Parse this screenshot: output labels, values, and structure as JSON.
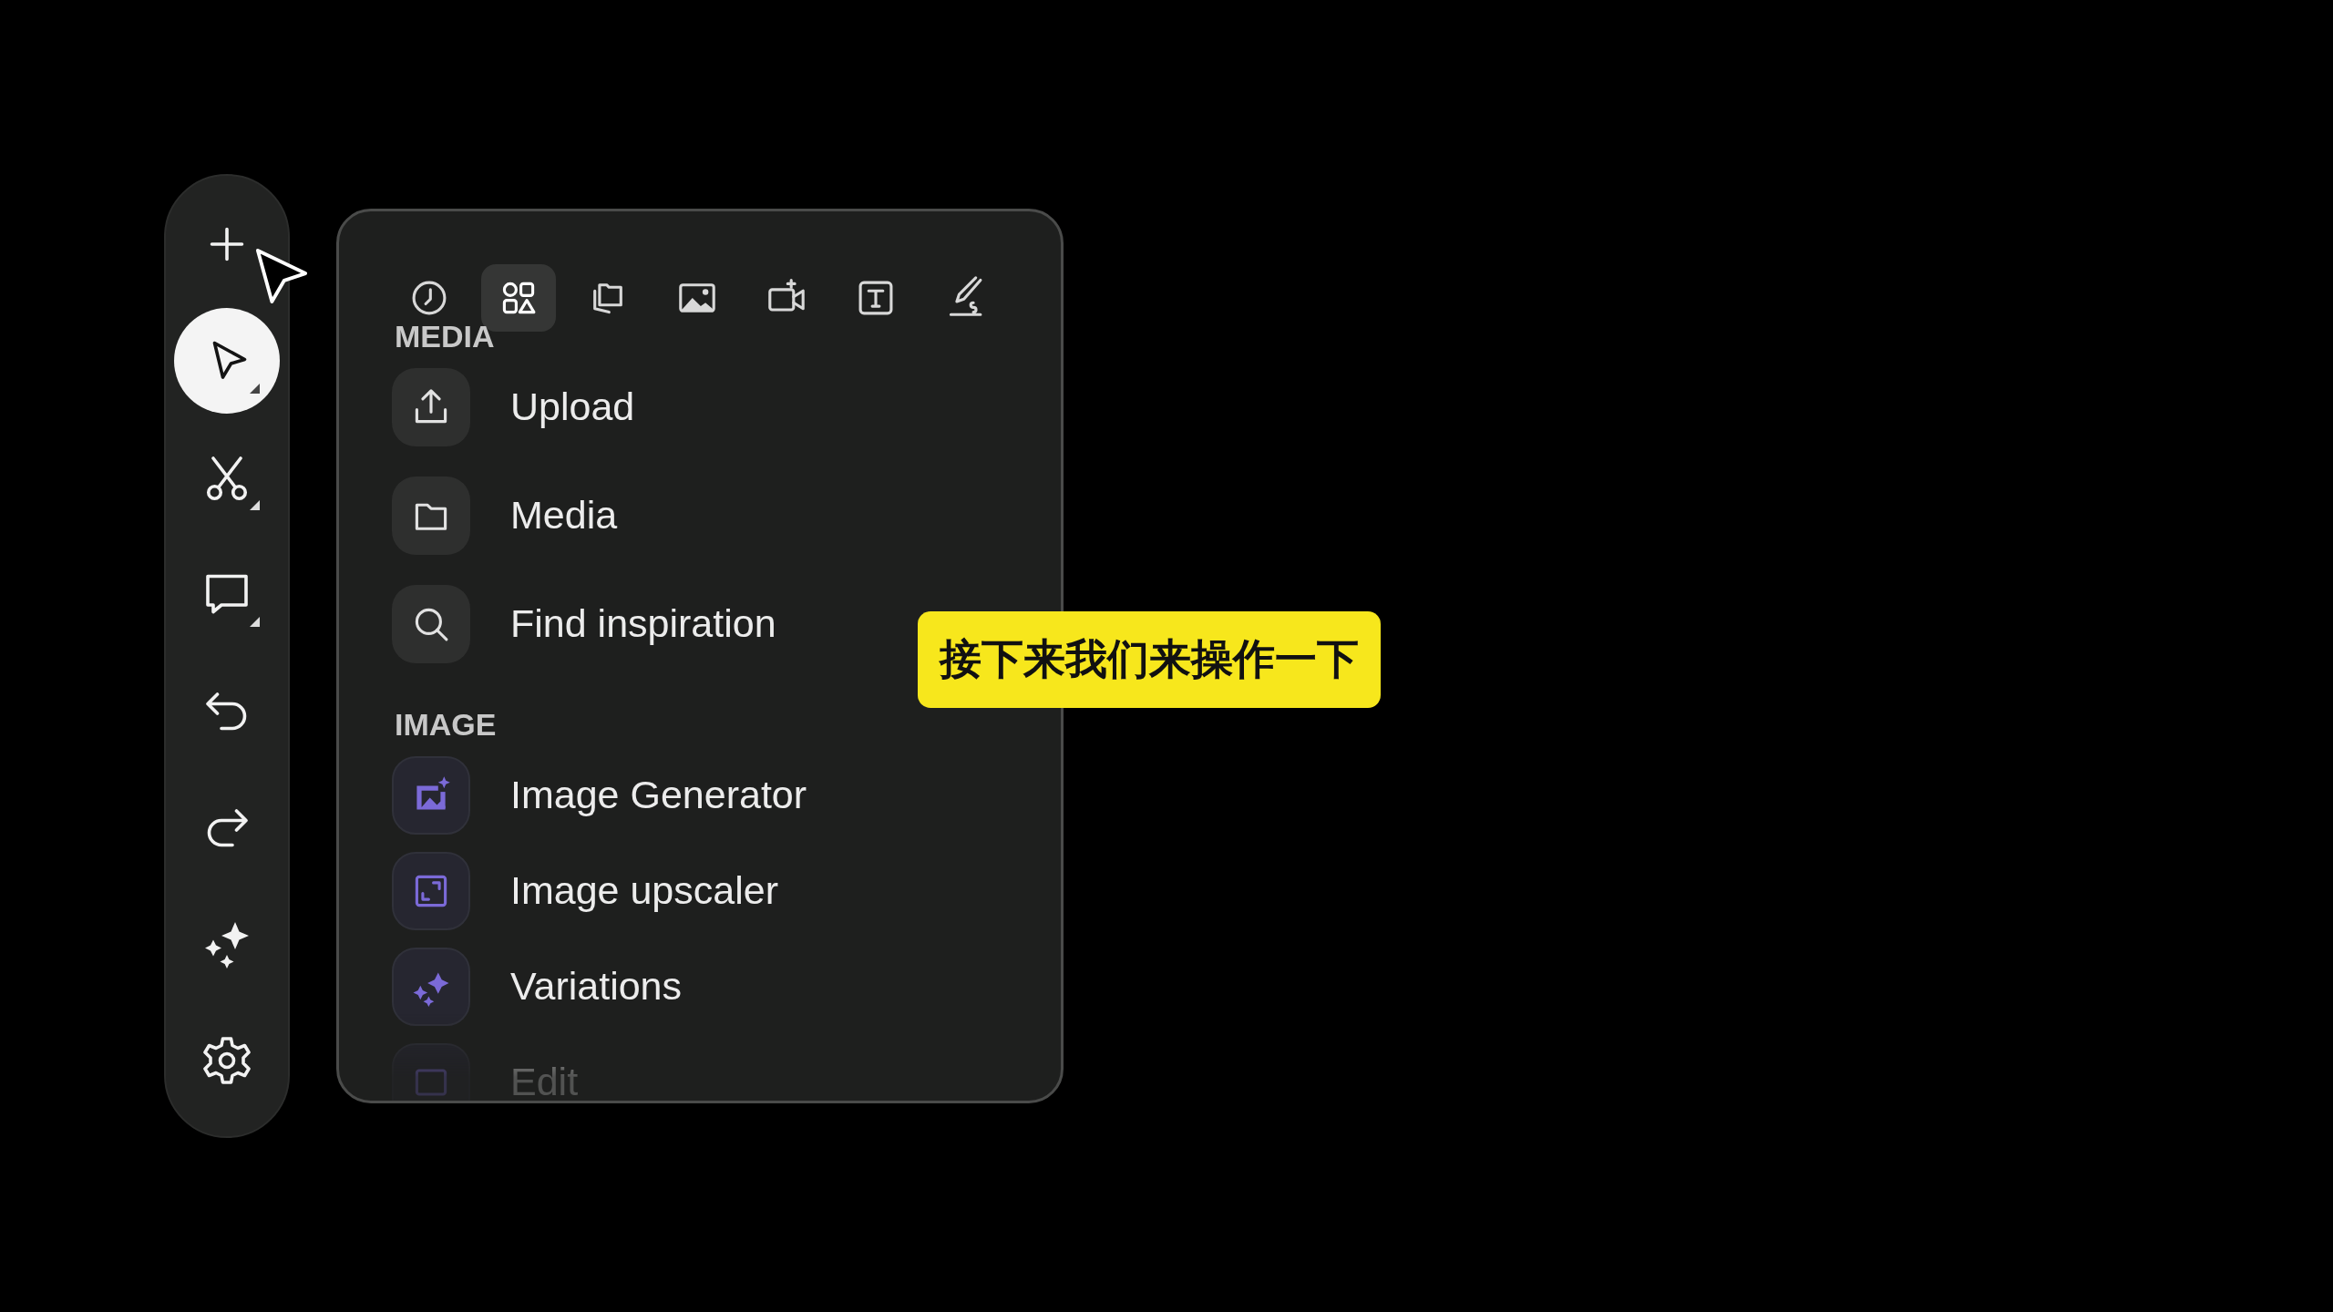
{
  "tools": [
    {
      "selected": false,
      "submenu": false
    },
    {
      "selected": true,
      "submenu": true
    },
    {
      "selected": false,
      "submenu": true
    },
    {
      "selected": false,
      "submenu": true
    },
    {
      "selected": false,
      "submenu": false
    },
    {
      "selected": false,
      "submenu": false
    },
    {
      "selected": false,
      "submenu": false
    },
    {
      "selected": false,
      "submenu": false
    }
  ],
  "panel": {
    "tabs": [
      {
        "selected": false
      },
      {
        "selected": true
      },
      {
        "selected": false
      },
      {
        "selected": false
      },
      {
        "selected": false
      },
      {
        "selected": false
      },
      {
        "selected": false
      }
    ],
    "sections": [
      {
        "title": "MEDIA",
        "items": [
          {
            "label": "Upload"
          },
          {
            "label": "Media"
          },
          {
            "label": "Find inspiration"
          }
        ]
      },
      {
        "title": "IMAGE",
        "items": [
          {
            "label": "Image Generator"
          },
          {
            "label": "Image upscaler"
          },
          {
            "label": "Variations"
          },
          {
            "label": "Edit"
          }
        ]
      }
    ]
  },
  "subtitle": "接下来我们来操作一下"
}
